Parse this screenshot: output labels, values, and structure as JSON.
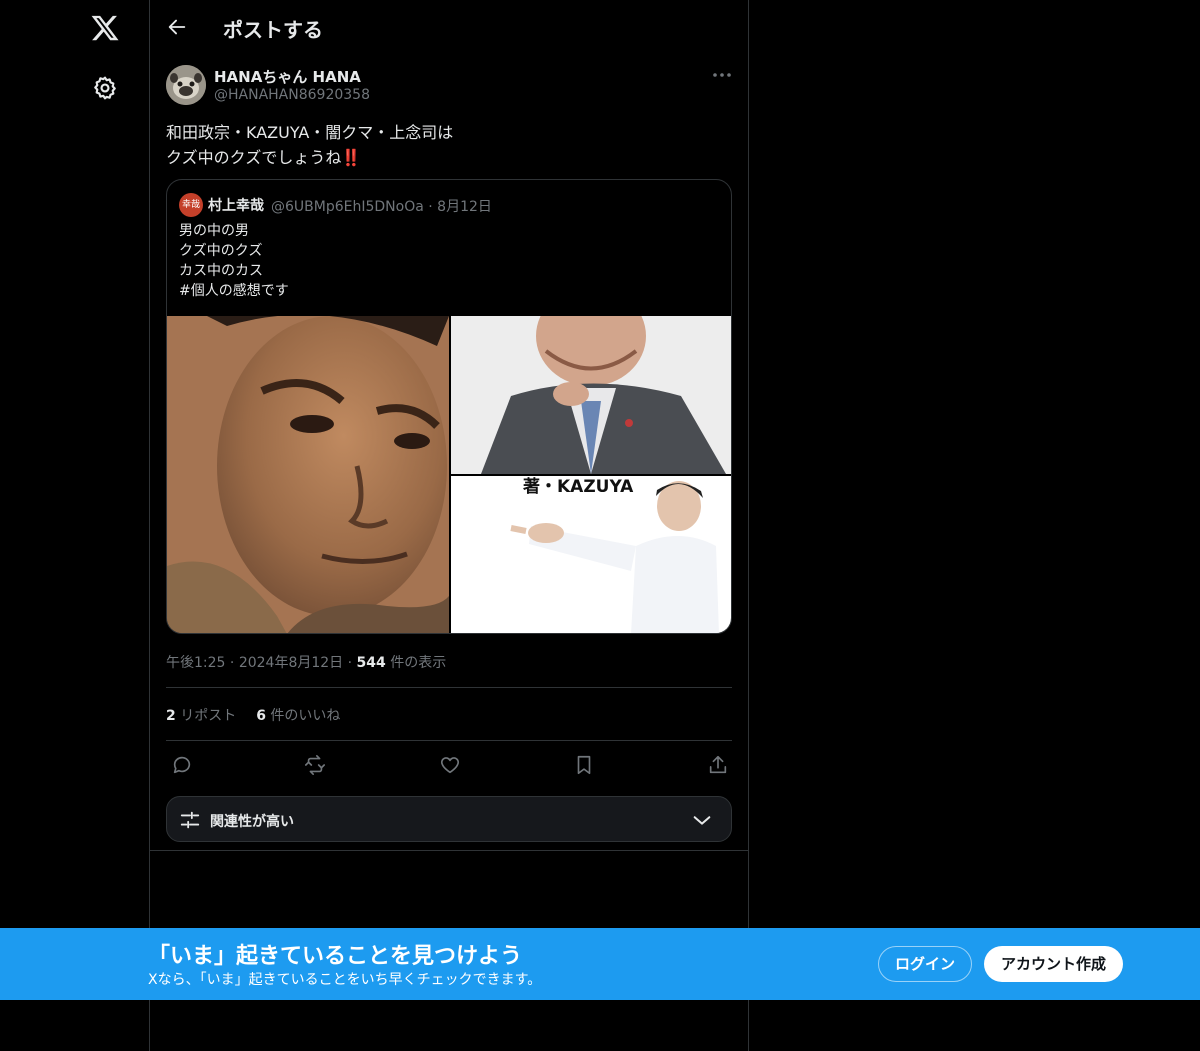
{
  "nav": {
    "logo_icon": "x-logo-icon",
    "settings_icon": "gear-icon"
  },
  "header": {
    "back_icon": "arrow-left-icon",
    "title": "ポストする"
  },
  "post": {
    "author_name": "HANAちゃん HANA",
    "author_handle": "@HANAHAN86920358",
    "text_line1": "和田政宗・KAZUYA・闇クマ・上念司は",
    "text_line2": "クズ中のクズでしょうね",
    "text_emoji": "‼️",
    "time": "午後1:25",
    "date": "2024年8月12日",
    "views_count": "544",
    "views_label": "件の表示",
    "reposts_count": "2",
    "reposts_label": "リポスト",
    "likes_count": "6",
    "likes_label": "件のいいね"
  },
  "quote": {
    "avatar_text": "幸哉",
    "author_name": "村上幸哉",
    "author_handle": "@6UBMp6EhI5DNoOa",
    "date": "8月12日",
    "lines": [
      "男の中の男",
      "クズ中のクズ",
      "カス中のカス",
      "#個人の感想です"
    ],
    "image3_caption": "著・KAZUYA"
  },
  "actions": [
    "reply-icon",
    "repost-icon",
    "like-icon",
    "bookmark-icon",
    "share-icon"
  ],
  "sort": {
    "label": "関連性が高い",
    "icon": "sliders-icon",
    "chevron": "chevron-down-icon"
  },
  "banner": {
    "title": "「いま」起きていることを見つけよう",
    "subtitle": "Xなら、「いま」起きていることをいち早くチェックできます。",
    "login_label": "ログイン",
    "signup_label": "アカウント作成"
  },
  "colors": {
    "accent": "#1d9bf0",
    "background": "#000000",
    "text": "#e7e9ea",
    "muted": "#71767b",
    "border": "#2f3336"
  }
}
